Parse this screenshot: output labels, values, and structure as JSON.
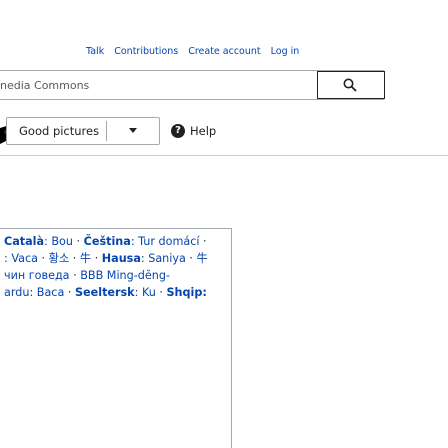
{
  "personal_tools": {
    "talk": "Talk",
    "contributions": "Contributions",
    "create_account": "Create account",
    "log_in": "Log in"
  },
  "search": {
    "value": "nedia Commons",
    "button_icon": "search-icon"
  },
  "widget": {
    "dropdown_label": "Good pictures",
    "dropdown_chevron_icon": "chevron-down-icon",
    "help_label": "Help"
  },
  "languages": {
    "lines": [
      [
        {
          "lang": "Català",
          "word": "Bou"
        },
        {
          "lang": "Čeština",
          "word": "Tur domácí"
        }
      ],
      [
        {
          "lang": "",
          "word": "Vaca"
        },
        {
          "lang": "",
          "word": "황소"
        },
        {
          "lang": "",
          "word": "牛"
        },
        {
          "lang": "Hausa",
          "word": "Saniya"
        },
        {
          "lang": "",
          "word": "牛"
        }
      ],
      [
        {
          "lang": "",
          "word": "чин говеда"
        },
        {
          "lang": "",
          "word": "BBB Ming-dĕng-"
        }
      ],
      [
        {
          "lang": "",
          "word": "ardu: Baca"
        },
        {
          "lang": "Seeltersk",
          "word": "Ku"
        },
        {
          "lang": "",
          "word": "Shqip:"
        }
      ]
    ]
  }
}
